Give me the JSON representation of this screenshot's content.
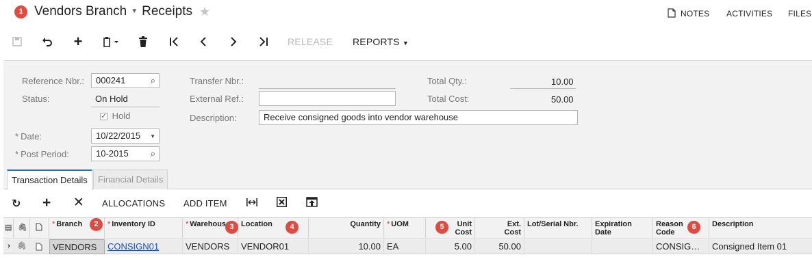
{
  "header": {
    "title": "Vendors Branch",
    "subtitle": "Receipts",
    "links": {
      "notes": "NOTES",
      "activities": "ACTIVITIES",
      "files": "FILES"
    }
  },
  "badges": [
    "1",
    "2",
    "3",
    "4",
    "5",
    "6"
  ],
  "toolbar": {
    "release": "RELEASE",
    "reports": "REPORTS"
  },
  "form": {
    "reference_nbr": {
      "label": "Reference Nbr.:",
      "value": "000241"
    },
    "status": {
      "label": "Status:",
      "value": "On Hold"
    },
    "hold": {
      "label": "Hold",
      "checked": true
    },
    "date": {
      "label": "Date:",
      "value": "10/22/2015"
    },
    "post_period": {
      "label": "Post Period:",
      "value": "10-2015"
    },
    "transfer_nbr": {
      "label": "Transfer Nbr.:",
      "value": ""
    },
    "external_ref": {
      "label": "External Ref.:",
      "value": ""
    },
    "description": {
      "label": "Description:",
      "value": "Receive consigned goods into vendor warehouse"
    },
    "total_qty": {
      "label": "Total Qty.:",
      "value": "10.00"
    },
    "total_cost": {
      "label": "Total Cost:",
      "value": "50.00"
    }
  },
  "tabs": [
    {
      "label": "Transaction Details",
      "active": true
    },
    {
      "label": "Financial Details",
      "active": false
    }
  ],
  "grid_toolbar": {
    "allocations": "ALLOCATIONS",
    "add_item": "ADD ITEM"
  },
  "grid": {
    "columns": {
      "branch": "Branch",
      "inventory_id": "Inventory ID",
      "warehouse": "Warehouse",
      "location": "Location",
      "quantity": "Quantity",
      "uom": "UOM",
      "unit_cost_1": "Unit",
      "unit_cost_2": "Cost",
      "ext_cost_1": "Ext.",
      "ext_cost_2": "Cost",
      "lot_serial": "Lot/Serial Nbr.",
      "expiration_1": "Expiration",
      "expiration_2": "Date",
      "reason_1": "Reason",
      "reason_2": "Code",
      "description": "Description"
    },
    "rows": [
      {
        "branch": "VENDORS",
        "inventory_id": "CONSIGN01",
        "warehouse": "VENDORS",
        "location": "VENDOR01",
        "quantity": "10.00",
        "uom": "EA",
        "unit_cost": "5.00",
        "ext_cost": "50.00",
        "lot_serial": "",
        "expiration": "",
        "reason_code": "CONSIG…",
        "description": "Consigned Item 01"
      }
    ]
  },
  "colors": {
    "accent": "#1e73be",
    "badge": "#e04a3f",
    "required": "#e0302d",
    "link": "#1f4fc7"
  }
}
